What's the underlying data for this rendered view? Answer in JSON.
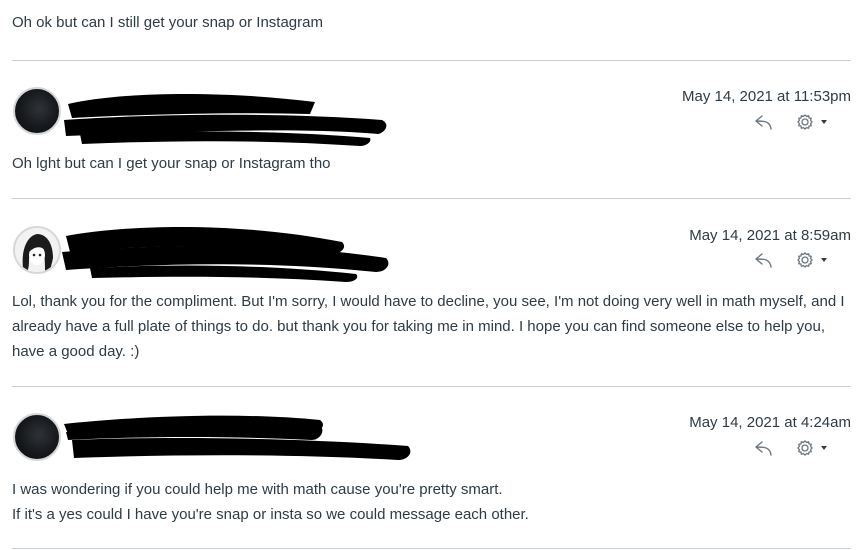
{
  "top_message": "Oh ok but can I still get your snap or Instagram",
  "entries": [
    {
      "timestamp": "May 14, 2021 at 11:53pm",
      "message": "Oh lght but can I get your snap or Instagram tho",
      "avatar": "dark-avatar"
    },
    {
      "timestamp": "May 14, 2021 at 8:59am",
      "message": "Lol, thank you for the compliment. But I'm sorry, I would have to decline, you see, I'm not doing very well in math myself, and I already have a full plate of things to do. but thank you for taking me in mind. I hope you can find someone else to help you, have a good day. :)",
      "avatar": "anime-avatar"
    },
    {
      "timestamp": "May 14, 2021 at 4:24am",
      "message_line1": "I was wondering if you could help me with math cause you're pretty smart.",
      "message_line2": "If it's a yes could I have you're snap or insta so we could message each other.",
      "avatar": "dark-avatar"
    }
  ],
  "icons": {
    "reply": "reply-icon",
    "settings": "gear-icon",
    "caret": "caret-down-icon"
  },
  "colors": {
    "text": "#2d3b45",
    "divider": "#c7cdd1",
    "icon": "#6b7780",
    "redaction": "#000000"
  }
}
